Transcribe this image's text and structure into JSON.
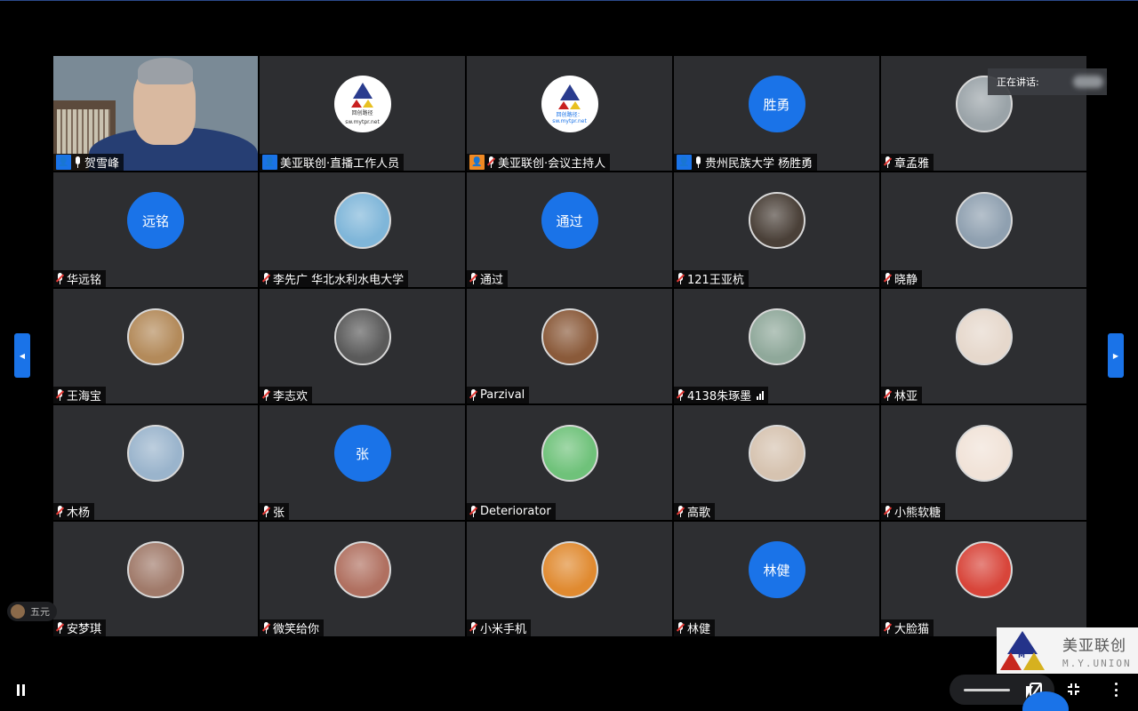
{
  "speaking_indicator": {
    "label": "正在讲话:"
  },
  "reaction": {
    "name": "五元"
  },
  "brand": {
    "name_cn": "美亚联创",
    "name_en": "M.Y.UNION"
  },
  "logo_tiles": {
    "line1": "回创路径",
    "url": "sw.mytpr.net",
    "alt": "回创路径：sw.mytpr.net"
  },
  "participants": [
    {
      "name": "贺雪峰",
      "role": "host",
      "mic": "on",
      "avatar": {
        "type": "video"
      }
    },
    {
      "name": "美亚联创·直播工作人员",
      "role": "host",
      "mic": "none",
      "avatar": {
        "type": "logo"
      }
    },
    {
      "name": "美亚联创·会议主持人",
      "role": "cohost",
      "mic": "muted",
      "avatar": {
        "type": "logo"
      }
    },
    {
      "name": "贵州民族大学 杨胜勇",
      "role": "host",
      "mic": "on",
      "avatar": {
        "type": "text",
        "text": "胜勇"
      }
    },
    {
      "name": "章孟雅",
      "role": "none",
      "mic": "muted",
      "avatar": {
        "type": "photo",
        "color": "#9aa3a8"
      }
    },
    {
      "name": "华远铭",
      "role": "none",
      "mic": "muted",
      "avatar": {
        "type": "text",
        "text": "远铭"
      }
    },
    {
      "name": "李先广 华北水利水电大学",
      "role": "none",
      "mic": "muted",
      "avatar": {
        "type": "photo",
        "color": "#7fb6d9"
      }
    },
    {
      "name": "通过",
      "role": "none",
      "mic": "muted",
      "avatar": {
        "type": "text",
        "text": "通过"
      }
    },
    {
      "name": "121王亚杭",
      "role": "none",
      "mic": "muted",
      "avatar": {
        "type": "photo",
        "color": "#4a4038"
      }
    },
    {
      "name": "晓静",
      "role": "none",
      "mic": "muted",
      "avatar": {
        "type": "photo",
        "color": "#8fa0b0"
      }
    },
    {
      "name": "王海宝",
      "role": "none",
      "mic": "muted",
      "avatar": {
        "type": "photo",
        "color": "#b38a5a"
      }
    },
    {
      "name": "李志欢",
      "role": "none",
      "mic": "muted",
      "avatar": {
        "type": "photo",
        "color": "#5a5a5a"
      }
    },
    {
      "name": "Parzival",
      "role": "none",
      "mic": "muted",
      "avatar": {
        "type": "photo",
        "color": "#8a5a3a"
      }
    },
    {
      "name": "4138朱琢墨",
      "role": "none",
      "mic": "muted",
      "signal": true,
      "avatar": {
        "type": "photo",
        "color": "#8fa89a"
      }
    },
    {
      "name": "林亚",
      "role": "none",
      "mic": "muted",
      "avatar": {
        "type": "photo",
        "color": "#e6d8cc"
      }
    },
    {
      "name": "木杨",
      "role": "none",
      "mic": "muted",
      "avatar": {
        "type": "photo",
        "color": "#9ab4cc"
      }
    },
    {
      "name": "张",
      "role": "none",
      "mic": "muted",
      "avatar": {
        "type": "text",
        "text": "张"
      }
    },
    {
      "name": "Deteriorator",
      "role": "none",
      "mic": "muted",
      "avatar": {
        "type": "photo",
        "color": "#6fc27a"
      }
    },
    {
      "name": "高歌",
      "role": "none",
      "mic": "muted",
      "avatar": {
        "type": "photo",
        "color": "#d6c3b0"
      }
    },
    {
      "name": "小熊软糖",
      "role": "none",
      "mic": "muted",
      "avatar": {
        "type": "photo",
        "color": "#f1e3d8"
      }
    },
    {
      "name": "安梦琪",
      "role": "none",
      "mic": "muted",
      "avatar": {
        "type": "photo",
        "color": "#a07a6a"
      }
    },
    {
      "name": "微笑给你",
      "role": "none",
      "mic": "muted",
      "avatar": {
        "type": "photo",
        "color": "#b07060"
      }
    },
    {
      "name": "小米手机",
      "role": "none",
      "mic": "muted",
      "avatar": {
        "type": "photo",
        "color": "#e08a30"
      }
    },
    {
      "name": "林健",
      "role": "none",
      "mic": "muted",
      "avatar": {
        "type": "text",
        "text": "林健"
      }
    },
    {
      "name": "大脸猫",
      "role": "none",
      "mic": "muted",
      "avatar": {
        "type": "photo",
        "color": "#d8453a"
      }
    }
  ]
}
